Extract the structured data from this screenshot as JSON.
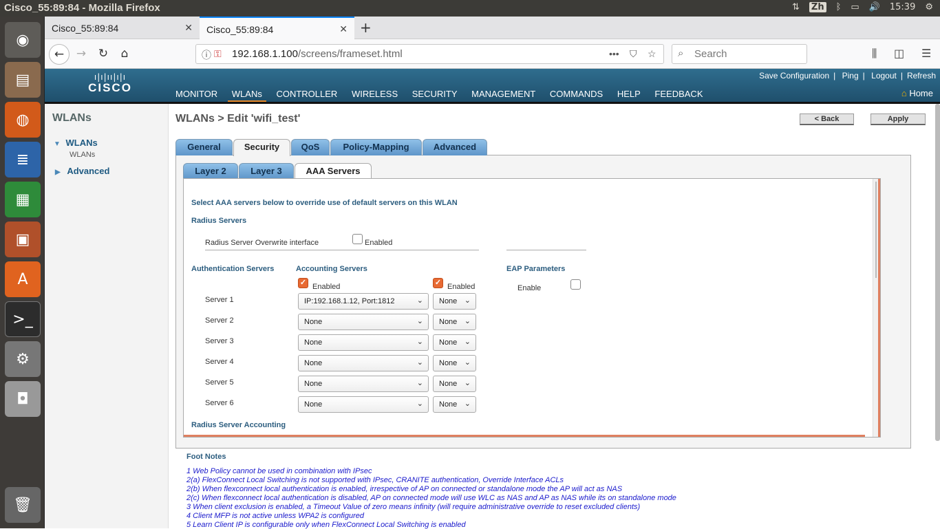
{
  "window": {
    "title": "Cisco_55:89:84 - Mozilla Firefox",
    "lang": "Zh",
    "time": "15:39"
  },
  "browser": {
    "tabs": [
      {
        "label": "Cisco_55:89:84"
      },
      {
        "label": "Cisco_55:89:84"
      }
    ],
    "url_host": "192.168.1.100",
    "url_path": "/screens/frameset.html",
    "search_placeholder": "Search"
  },
  "header": {
    "links": [
      "Save Configuration",
      "Ping",
      "Logout",
      "Refresh"
    ],
    "menu": [
      "MONITOR",
      "WLANs",
      "CONTROLLER",
      "WIRELESS",
      "SECURITY",
      "MANAGEMENT",
      "COMMANDS",
      "HELP",
      "FEEDBACK"
    ],
    "selected_menu": "WLANs",
    "home": "Home",
    "logo_text": "CISCO"
  },
  "sidebar": {
    "title": "WLANs",
    "items": [
      {
        "label": "WLANs"
      },
      {
        "label": "WLANs"
      },
      {
        "label": "Advanced"
      }
    ]
  },
  "page": {
    "title": "WLANs > Edit  'wifi_test'",
    "back": "< Back",
    "apply": "Apply",
    "tabs": [
      "General",
      "Security",
      "QoS",
      "Policy-Mapping",
      "Advanced"
    ],
    "subtabs": [
      "Layer 2",
      "Layer 3",
      "AAA Servers"
    ],
    "intro": "Select AAA servers below to override use of default servers on this WLAN",
    "radius_servers": "Radius Servers",
    "overwrite_label": "Radius Server Overwrite interface",
    "enabled": "Enabled",
    "auth_header": "Authentication Servers",
    "acct_header": "Accounting Servers",
    "eap_header": "EAP Parameters",
    "eap_enable": "Enable",
    "servers": [
      {
        "label": "Server 1",
        "auth": "IP:192.168.1.12, Port:1812",
        "acct": "None"
      },
      {
        "label": "Server 2",
        "auth": "None",
        "acct": "None"
      },
      {
        "label": "Server 3",
        "auth": "None",
        "acct": "None"
      },
      {
        "label": "Server 4",
        "auth": "None",
        "acct": "None"
      },
      {
        "label": "Server 5",
        "auth": "None",
        "acct": "None"
      },
      {
        "label": "Server 6",
        "auth": "None",
        "acct": "None"
      }
    ],
    "radius_accounting": "Radius Server Accounting"
  },
  "footnotes": {
    "title": "Foot Notes",
    "lines": [
      "1 Web Policy cannot be used in combination with IPsec",
      "2(a) FlexConnect Local Switching is not supported with IPsec, CRANITE authentication, Override Interface ACLs",
      "2(b) When flexconnect local authentication is enabled, irrespective of AP on connected or standalone mode the AP will act as NAS",
      "2(c) When flexconnect local authentication is disabled, AP on connected mode will use WLC as NAS and AP as NAS while its on standalone mode",
      "3 When client exclusion is enabled, a Timeout Value of zero means infinity (will require administrative override to reset excluded clients)",
      "4 Client MFP is not active unless WPA2 is configured",
      "5 Learn Client IP is configurable only when FlexConnect Local Switching is enabled"
    ]
  }
}
